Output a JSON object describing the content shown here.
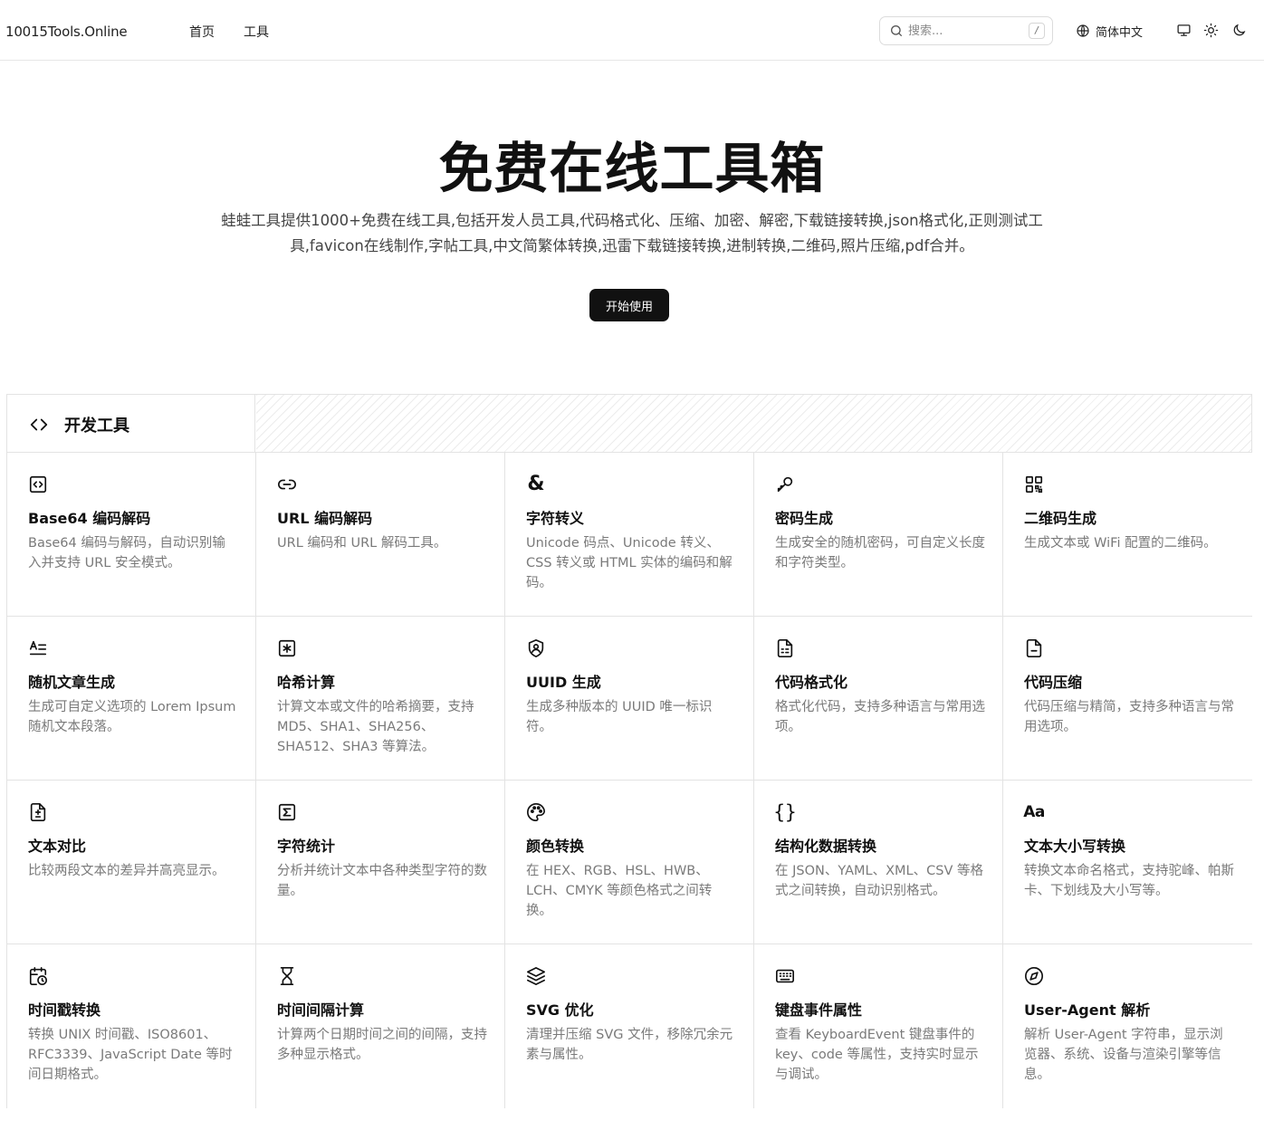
{
  "header": {
    "logo": "10015Tools.Online",
    "nav": [
      "首页",
      "工具"
    ],
    "search_placeholder": "搜索...",
    "search_shortcut": "/",
    "language": "简体中文",
    "icons": [
      "search-icon",
      "globe-icon",
      "monitor-icon",
      "sun-icon",
      "moon-icon"
    ]
  },
  "hero": {
    "title": "免费在线工具箱",
    "description": "蛙蛙工具提供1000+免费在线工具,包括开发人员工具,代码格式化、压缩、加密、解密,下载链接转换,json格式化,正则测试工具,favicon在线制作,字帖工具,中文简繁体转换,迅雷下载链接转换,进制转换,二维码,照片压缩,pdf合并。",
    "cta_label": "开始使用"
  },
  "section": {
    "title": "开发工具",
    "icon": "code-brackets-icon",
    "tools": [
      {
        "icon": "file-code-icon",
        "title": "Base64 编码解码",
        "desc": "Base64 编码与解码，自动识别输入并支持 URL 安全模式。"
      },
      {
        "icon": "link-icon",
        "title": "URL 编码解码",
        "desc": "URL 编码和 URL 解码工具。"
      },
      {
        "icon": "ampersand-icon",
        "title": "字符转义",
        "desc": "Unicode 码点、Unicode 转义、CSS 转义或 HTML 实体的编码和解码。"
      },
      {
        "icon": "key-icon",
        "title": "密码生成",
        "desc": "生成安全的随机密码，可自定义长度和字符类型。"
      },
      {
        "icon": "qr-code-icon",
        "title": "二维码生成",
        "desc": "生成文本或 WiFi 配置的二维码。"
      },
      {
        "icon": "text-lines-icon",
        "title": "随机文章生成",
        "desc": "生成可自定义选项的 Lorem Ipsum 随机文本段落。"
      },
      {
        "icon": "asterisk-square-icon",
        "title": "哈希计算",
        "desc": "计算文本或文件的哈希摘要，支持 MD5、SHA1、SHA256、SHA512、SHA3 等算法。"
      },
      {
        "icon": "shield-icon",
        "title": "UUID 生成",
        "desc": "生成多种版本的 UUID 唯一标识符。"
      },
      {
        "icon": "file-text-icon",
        "title": "代码格式化",
        "desc": "格式化代码，支持多种语言与常用选项。"
      },
      {
        "icon": "file-minus-icon",
        "title": "代码压缩",
        "desc": "代码压缩与精简，支持多种语言与常用选项。"
      },
      {
        "icon": "file-diff-icon",
        "title": "文本对比",
        "desc": "比较两段文本的差异并高亮显示。"
      },
      {
        "icon": "sigma-icon",
        "title": "字符统计",
        "desc": "分析并统计文本中各种类型字符的数量。"
      },
      {
        "icon": "palette-icon",
        "title": "颜色转换",
        "desc": "在 HEX、RGB、HSL、HWB、LCH、CMYK 等颜色格式之间转换。"
      },
      {
        "icon": "braces-icon",
        "title": "结构化数据转换",
        "desc": "在 JSON、YAML、XML、CSV 等格式之间转换，自动识别格式。"
      },
      {
        "icon": "case-icon",
        "title": "文本大小写转换",
        "desc": "转换文本命名格式，支持驼峰、帕斯卡、下划线及大小写等。"
      },
      {
        "icon": "calendar-clock-icon",
        "title": "时间戳转换",
        "desc": "转换 UNIX 时间戳、ISO8601、RFC3339、JavaScript Date 等时间日期格式。"
      },
      {
        "icon": "hourglass-icon",
        "title": "时间间隔计算",
        "desc": "计算两个日期时间之间的间隔，支持多种显示格式。"
      },
      {
        "icon": "layers-icon",
        "title": "SVG 优化",
        "desc": "清理并压缩 SVG 文件，移除冗余元素与属性。"
      },
      {
        "icon": "keyboard-icon",
        "title": "键盘事件属性",
        "desc": "查看 KeyboardEvent 键盘事件的 key、code 等属性，支持实时显示与调试。"
      },
      {
        "icon": "compass-icon",
        "title": "User-Agent 解析",
        "desc": "解析 User-Agent 字符串，显示浏览器、系统、设备与渲染引擎等信息。"
      }
    ]
  }
}
